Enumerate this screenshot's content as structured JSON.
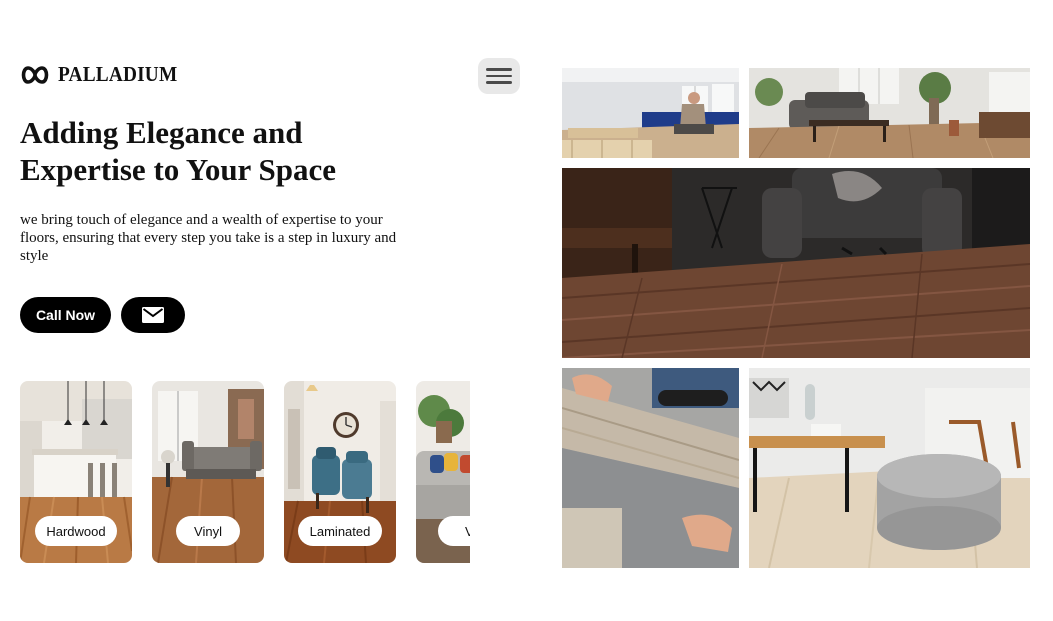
{
  "brand": {
    "name": "PALLADIUM",
    "logo_icon": "infinity-icon"
  },
  "header": {
    "menu_icon": "hamburger-menu-icon"
  },
  "hero": {
    "title_line1": "Adding Elegance and",
    "title_line2": "Expertise to Your Space",
    "subtitle": "we bring touch of elegance and a wealth of expertise to your floors, ensuring that every step you take is a step in luxury and style"
  },
  "actions": {
    "call_label": "Call Now",
    "mail_icon": "envelope-icon"
  },
  "categories": [
    {
      "label": "Hardwood"
    },
    {
      "label": "Vinyl"
    },
    {
      "label": "Laminated"
    },
    {
      "label": "View"
    }
  ],
  "gallery": [
    {
      "name": "installer-kneeling-photo"
    },
    {
      "name": "living-room-sofa-photo"
    },
    {
      "name": "piano-armchair-floor-photo"
    },
    {
      "name": "laying-vinyl-planks-photo"
    },
    {
      "name": "ottoman-coffee-table-photo"
    }
  ],
  "colors": {
    "text": "#111111",
    "button_bg": "#000000",
    "button_text": "#ffffff",
    "menu_bg": "#e8e8e8",
    "page_bg": "#ffffff"
  }
}
